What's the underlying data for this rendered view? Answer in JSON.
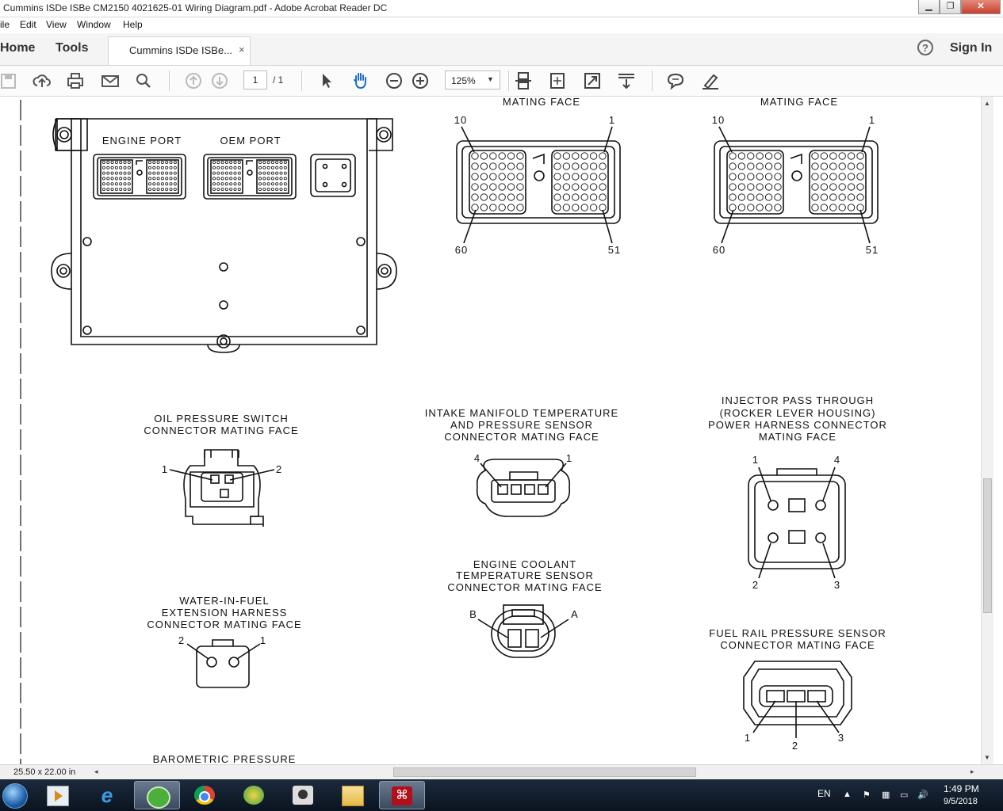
{
  "window": {
    "title": "Cummins ISDe ISBe CM2150 4021625-01 Wiring Diagram.pdf - Adobe Acrobat Reader DC",
    "controls": [
      "minimize",
      "restore",
      "close"
    ]
  },
  "menu": [
    "ile",
    "Edit",
    "View",
    "Window",
    "Help"
  ],
  "tabs": {
    "home": "Home",
    "tools": "Tools",
    "document": "Cummins ISDe ISBe...",
    "close_glyph": "×",
    "help": "?",
    "sign_in": "Sign In"
  },
  "toolbar": {
    "page_current": "1",
    "page_total": "/ 1",
    "zoom": "125%",
    "icons": [
      "save-icon",
      "upload-icon",
      "print-icon",
      "email-icon",
      "search-icon",
      "prev-page-icon",
      "next-page-icon",
      "select-cursor-icon",
      "hand-tool-icon",
      "zoom-out-icon",
      "zoom-in-icon",
      "scroll-mode-icon",
      "fit-page-icon",
      "fullscreen-icon",
      "read-mode-icon",
      "comment-icon",
      "highlight-icon"
    ]
  },
  "diagram": {
    "mating_face_1": "MATING FACE",
    "mating_face_2": "MATING FACE",
    "engine_port": "ENGINE PORT",
    "oem_port": "OEM PORT",
    "pins": {
      "p10": "10",
      "p1": "1",
      "p60": "60",
      "p51": "51"
    },
    "oil_pressure": {
      "line1": "OIL PRESSURE SWITCH",
      "line2": "CONNECTOR MATING FACE",
      "pin1": "1",
      "pin2": "2"
    },
    "intake_manifold": {
      "line1": "INTAKE MANIFOLD TEMPERATURE",
      "line2": "AND PRESSURE SENSOR",
      "line3": "CONNECTOR MATING FACE",
      "pin4": "4",
      "pin1": "1"
    },
    "injector": {
      "line1": "INJECTOR PASS THROUGH",
      "line2": "(ROCKER LEVER HOUSING)",
      "line3": "POWER HARNESS CONNECTOR",
      "line4": "MATING FACE",
      "pin1": "1",
      "pin4": "4",
      "pin2": "2",
      "pin3": "3"
    },
    "water_in_fuel": {
      "line1": "WATER-IN-FUEL",
      "line2": "EXTENSION HARNESS",
      "line3": "CONNECTOR MATING FACE",
      "pin2": "2",
      "pin1": "1"
    },
    "coolant": {
      "line1": "ENGINE COOLANT",
      "line2": "TEMPERATURE SENSOR",
      "line3": "CONNECTOR MATING FACE",
      "pinB": "B",
      "pinA": "A"
    },
    "fuel_rail": {
      "line1": "FUEL RAIL PRESSURE SENSOR",
      "line2": "CONNECTOR MATING FACE",
      "pin1": "1",
      "pin2": "2",
      "pin3": "3"
    },
    "barometric": "BAROMETRIC PRESSURE"
  },
  "status": {
    "page_size": "25.50 x 22.00 in"
  },
  "taskbar": {
    "apps": [
      "start-orb-icon",
      "media-player-icon",
      "internet-explorer-icon",
      "green-app-icon",
      "chrome-icon",
      "bird-app-icon",
      "camera-app-icon",
      "file-explorer-icon",
      "acrobat-reader-icon"
    ],
    "lang": "EN",
    "time": "1:49 PM",
    "date": "9/5/2018"
  }
}
